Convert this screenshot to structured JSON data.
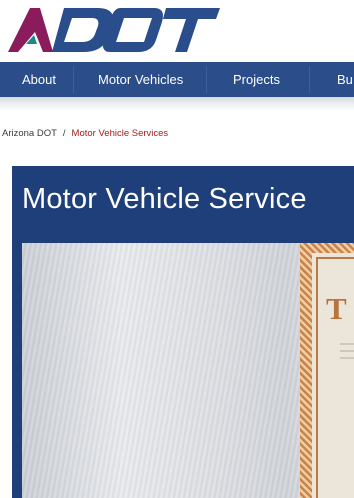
{
  "logo": {
    "text": "ADOT",
    "accent_color": "#8a1c5c",
    "primary_color": "#2a4d8b",
    "teal_color": "#1c8a8a"
  },
  "nav": {
    "background": "#2b4d8a",
    "items": [
      {
        "label": "About"
      },
      {
        "label": "Motor Vehicles"
      },
      {
        "label": "Projects"
      },
      {
        "label": "Bu"
      }
    ]
  },
  "breadcrumb": {
    "home": "Arizona DOT",
    "separator": "/",
    "current": "Motor Vehicle Services"
  },
  "hero": {
    "title": "Motor Vehicle Service",
    "background": "#1f3f7a",
    "image": {
      "subject": "title-certificate",
      "visible_letter": "T"
    }
  }
}
